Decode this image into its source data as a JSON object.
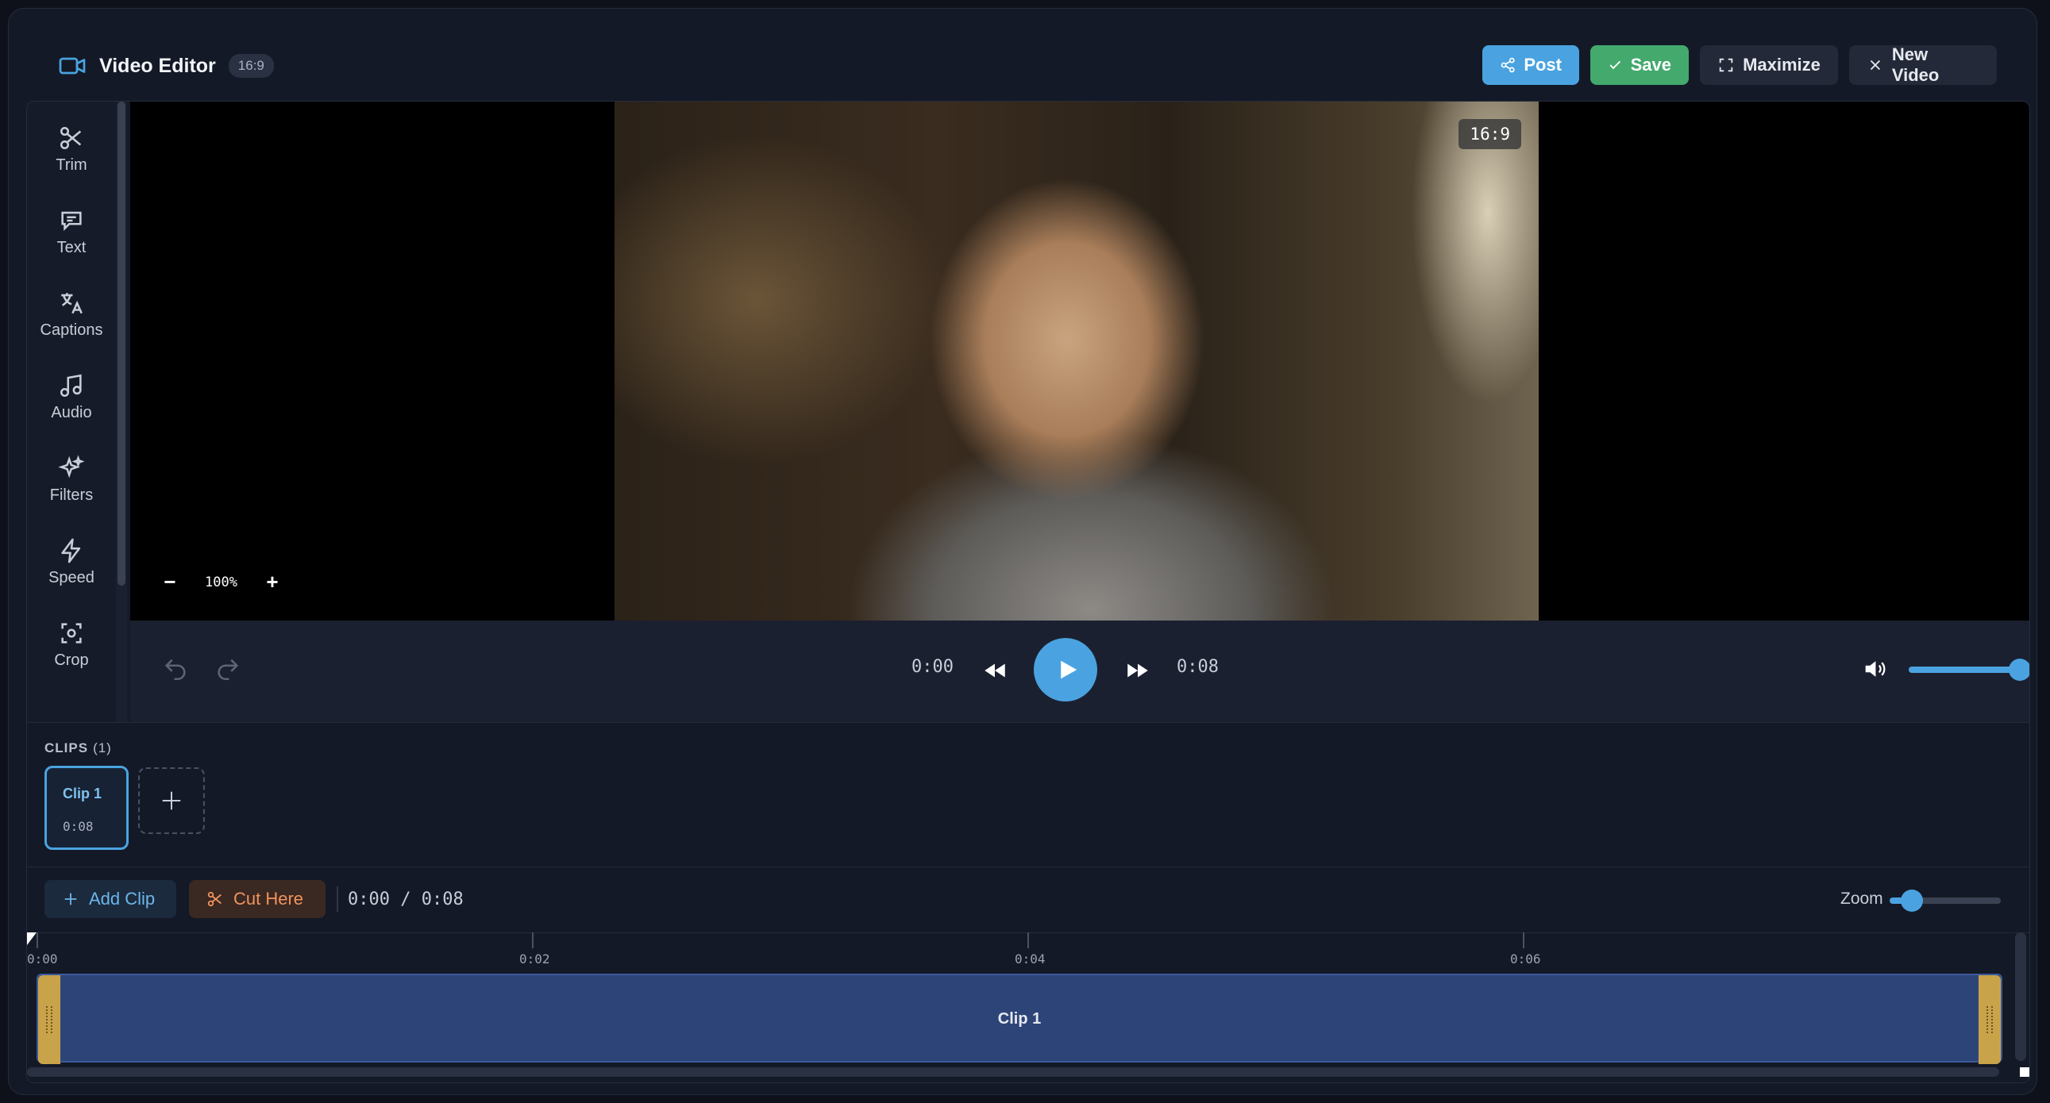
{
  "header": {
    "title": "Video Editor",
    "ratio_badge": "16:9",
    "buttons": {
      "post": "Post",
      "save": "Save",
      "maximize": "Maximize",
      "new_video": "New Video"
    }
  },
  "sidebar": {
    "tools": [
      {
        "label": "Trim",
        "icon": "scissors-icon"
      },
      {
        "label": "Text",
        "icon": "speech-bubble-icon"
      },
      {
        "label": "Captions",
        "icon": "translate-icon"
      },
      {
        "label": "Audio",
        "icon": "music-note-icon"
      },
      {
        "label": "Filters",
        "icon": "sparkles-icon"
      },
      {
        "label": "Speed",
        "icon": "lightning-icon"
      },
      {
        "label": "Crop",
        "icon": "focus-frame-icon"
      }
    ]
  },
  "preview": {
    "aspect_badge": "16:9",
    "zoom_value": "100%",
    "zoom_minus": "−",
    "zoom_plus": "+"
  },
  "transport": {
    "current_time": "0:00",
    "duration": "0:08",
    "volume_fraction": 1.0
  },
  "clips": {
    "label": "CLIPS",
    "count": "(1)",
    "items": [
      {
        "name": "Clip 1",
        "duration": "0:08"
      }
    ]
  },
  "timeline": {
    "add_clip": "Add Clip",
    "cut_here": "Cut Here",
    "time_display": "0:00 / 0:08",
    "zoom_label": "Zoom",
    "zoom_fraction": 0.2,
    "ruler_labels": [
      "0:00",
      "0:02",
      "0:04",
      "0:06"
    ],
    "track_clip_label": "Clip 1"
  },
  "colors": {
    "accent": "#4aa3e0",
    "save": "#43a96d",
    "cut": "#f0935c",
    "track_clip": "#2d4479",
    "handle": "#c9a34a"
  }
}
